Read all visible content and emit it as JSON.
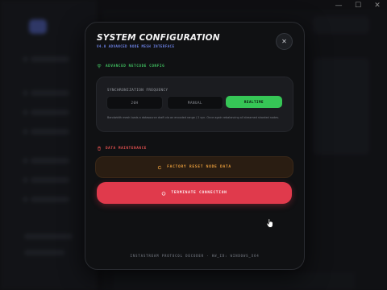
{
  "window_controls": {
    "minimize_glyph": "—",
    "maximize_glyph": "☐",
    "close_glyph": "✕"
  },
  "modal": {
    "title": "SYSTEM CONFIGURATION",
    "subtitle": "V4.0 ADVANCED NODE MESH INTERFACE",
    "close_glyph": "✕",
    "accent_color": "#6a7fe0"
  },
  "network_section": {
    "heading": "ADVANCED NETCODE CONFIG",
    "icon": "wifi-icon",
    "color": "#40c060",
    "frequency_label": "SYNCHRONIZATION FREQUENCY",
    "options": [
      "20H",
      "MANUAL",
      "REALTIME"
    ],
    "selected": "REALTIME",
    "description": "Bandwidth mesh loads a datasource draft via an encoded range / 2 syn. Once again rebalancing all streamed sharded nodes."
  },
  "data_section": {
    "heading": "DATA MAINTENANCE",
    "icon": "trash-icon",
    "color": "#e0504f",
    "factory_label": "FACTORY RESET NODE DATA",
    "factory_icon": "reset-icon",
    "factory_color": "#e39a3b",
    "terminate_label": "TERMINATE CONNECTION",
    "terminate_icon": "power-icon",
    "terminate_color": "#e03a4c"
  },
  "footer": {
    "text": "INSTASTREAM PROTOCOL DECODER · HW_ID: WINDOWS_X64"
  }
}
